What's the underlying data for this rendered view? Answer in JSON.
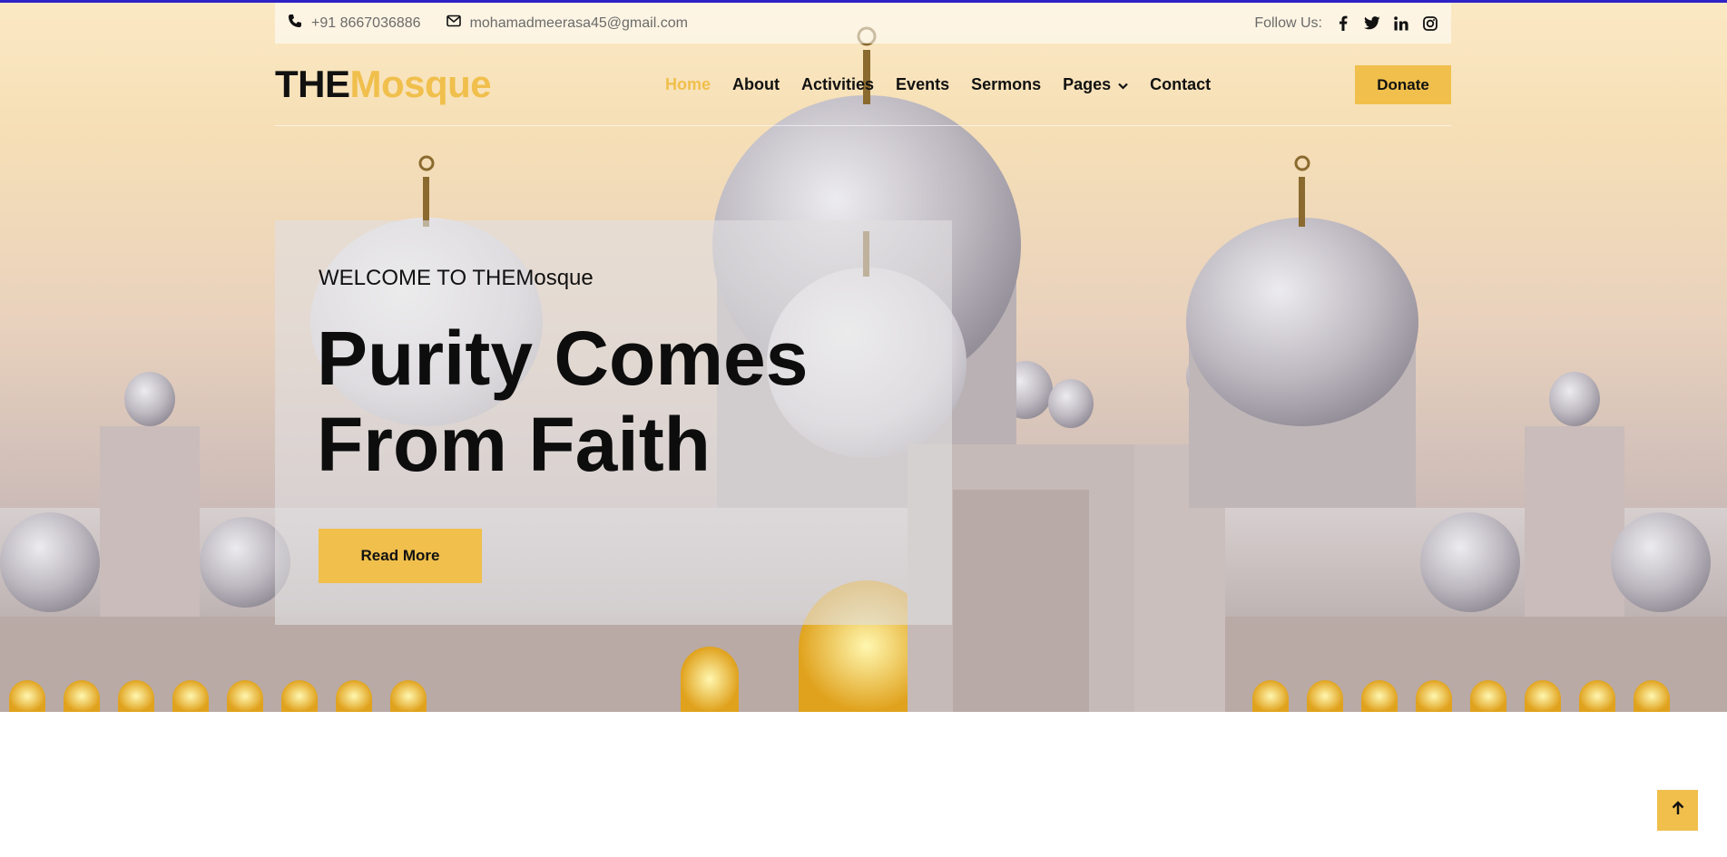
{
  "topbar": {
    "phone": "+91 8667036886",
    "email": "mohamadmeerasa45@gmail.com",
    "follow_label": "Follow Us:",
    "socials": [
      "facebook-icon",
      "twitter-icon",
      "linkedin-icon",
      "instagram-icon"
    ]
  },
  "brand": {
    "part1": "THE",
    "part2": "Mosque"
  },
  "nav": {
    "items": [
      {
        "label": "Home"
      },
      {
        "label": "About"
      },
      {
        "label": "Activities"
      },
      {
        "label": "Events"
      },
      {
        "label": "Sermons"
      },
      {
        "label": "Pages"
      },
      {
        "label": "Contact"
      }
    ],
    "donate_label": "Donate"
  },
  "hero": {
    "kicker": "WELCOME TO THEMosque",
    "headline": "Purity Comes From Faith",
    "cta_label": "Read More"
  },
  "colors": {
    "accent": "#f0bf4c",
    "top_accent": "#2e22c7",
    "text": "#111111"
  }
}
